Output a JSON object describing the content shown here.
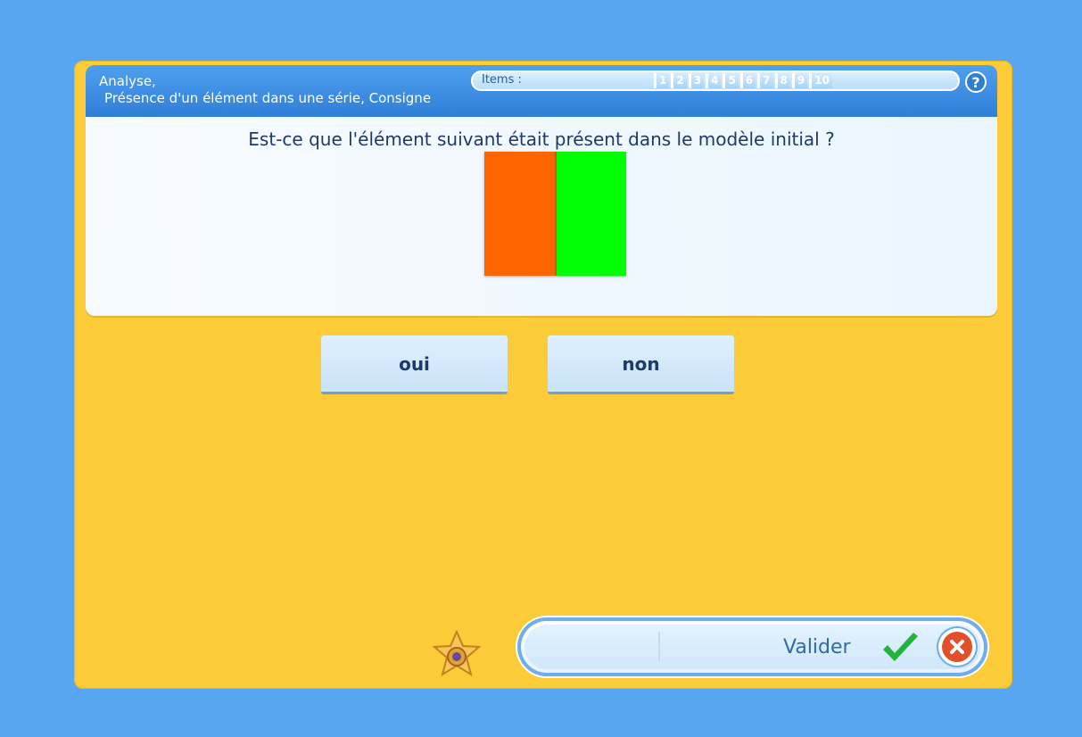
{
  "header": {
    "subject_line1": "Analyse,",
    "subject_line2": "Présence d'un élément dans une série, Consigne",
    "items_label": "Items :",
    "items": [
      "1",
      "2",
      "3",
      "4",
      "5",
      "6",
      "7",
      "8",
      "9",
      "10"
    ],
    "help_label": "?"
  },
  "question": {
    "text": "Est-ce que l'élément suivant était présent dans le modèle initial ?",
    "element_colors": [
      "#fe6500",
      "#02fe03"
    ]
  },
  "answers": {
    "yes_label": "oui",
    "no_label": "non"
  },
  "footer": {
    "validate_label": "Valider",
    "mascot_icon": "star-mascot-icon",
    "check_icon": "checkmark-icon",
    "cancel_icon": "close-circle-icon"
  },
  "colors": {
    "background": "#56a6f2",
    "frame": "#fccb38",
    "header": "#2f7fd8",
    "check": "#22b43a",
    "cancel": "#e1502a"
  }
}
